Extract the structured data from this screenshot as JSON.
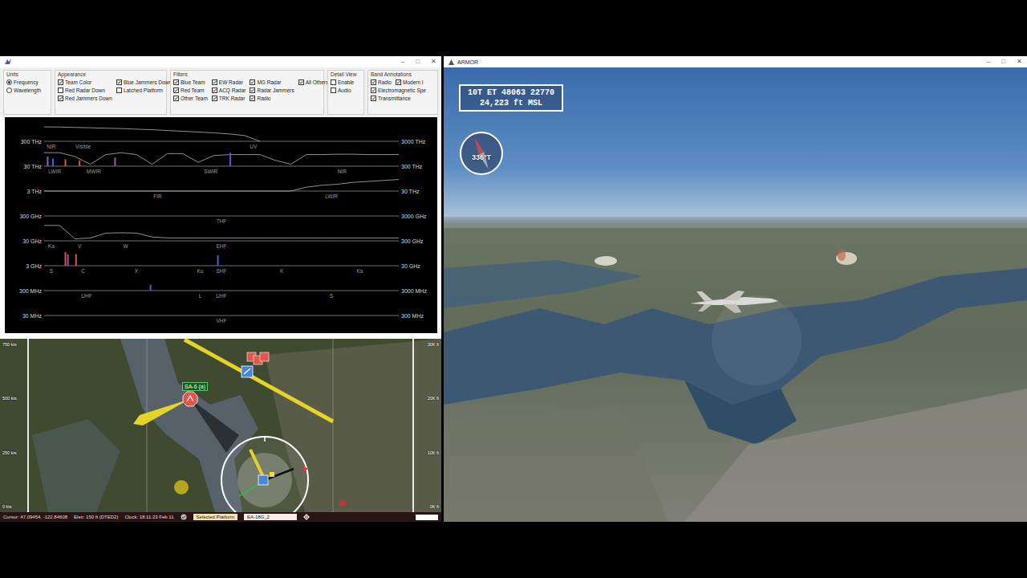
{
  "left_window": {
    "controls": [
      "–",
      "□",
      "✕"
    ],
    "option_groups": [
      {
        "title": "Units",
        "kind": "columns",
        "lines": [
          [
            {
              "label": "Frequency",
              "kind": "radio",
              "selected": true
            },
            {
              "label": "Wavelength",
              "kind": "radio",
              "selected": false
            }
          ]
        ]
      },
      {
        "title": "Appearance",
        "kind": "columns",
        "lines": [
          [
            {
              "label": "Team Color",
              "kind": "checkbox",
              "checked": true
            },
            {
              "label": "Red Radar Down",
              "kind": "checkbox",
              "checked": false
            },
            {
              "label": "Red Jammers Down",
              "kind": "checkbox",
              "checked": true
            }
          ],
          [
            {
              "label": "Blue Jammers Down",
              "kind": "checkbox",
              "checked": true
            },
            {
              "label": "Latched Platform",
              "kind": "checkbox",
              "checked": false
            }
          ]
        ]
      },
      {
        "title": "Filters",
        "kind": "columns",
        "lines": [
          [
            {
              "label": "Blue Team",
              "kind": "checkbox",
              "checked": true
            },
            {
              "label": "Red Team",
              "kind": "checkbox",
              "checked": true
            },
            {
              "label": "Other Team",
              "kind": "checkbox",
              "checked": true
            }
          ],
          [
            {
              "label": "EW Radar",
              "kind": "checkbox",
              "checked": true
            },
            {
              "label": "ACQ Radar",
              "kind": "checkbox",
              "checked": true
            },
            {
              "label": "TRK Radar",
              "kind": "checkbox",
              "checked": true
            }
          ],
          [
            {
              "label": "MG Radar",
              "kind": "checkbox",
              "checked": true
            },
            {
              "label": "Radar Jammers",
              "kind": "checkbox",
              "checked": true
            },
            {
              "label": "Radio",
              "kind": "checkbox",
              "checked": true
            }
          ],
          [
            {
              "label": "All Others",
              "kind": "checkbox",
              "checked": true
            }
          ]
        ]
      },
      {
        "title": "Detail View",
        "kind": "columns",
        "lines": [
          [
            {
              "label": "Enable",
              "kind": "checkbox",
              "checked": false
            },
            {
              "label": "Audio",
              "kind": "checkbox",
              "checked": false
            }
          ]
        ]
      },
      {
        "title": "Band Annotations",
        "kind": "rows",
        "lines": [
          [
            {
              "label": "Radio",
              "kind": "checkbox",
              "checked": true
            },
            {
              "label": "Modern I",
              "kind": "checkbox",
              "checked": true
            }
          ],
          [
            {
              "label": "Electromagnetic Spe",
              "kind": "checkbox",
              "checked": true
            }
          ],
          [
            {
              "label": "Transmittance",
              "kind": "checkbox",
              "checked": true
            }
          ]
        ]
      }
    ],
    "spectrum": {
      "rows": [
        {
          "left": "300 THz",
          "right": "3000 THz",
          "bands": [
            {
              "label": "NIR",
              "at": 0.02
            },
            {
              "label": "Visible",
              "at": 0.11
            },
            {
              "label": "UV",
              "at": 0.59
            }
          ],
          "transmittance": [
            0.75,
            0.74,
            0.72,
            0.7,
            0.68,
            0.66,
            0.63,
            0.6,
            0.56,
            0.52,
            0.48,
            0.44,
            0.38,
            0.3,
            0.0
          ],
          "signals": []
        },
        {
          "left": "30 THz",
          "right": "300 THz",
          "bands": [
            {
              "label": "LWIR",
              "at": 0.03
            },
            {
              "label": "MWIR",
              "at": 0.14
            },
            {
              "label": "SWIR",
              "at": 0.47
            },
            {
              "label": "NIR",
              "at": 0.84
            }
          ],
          "transmittance": [
            0.7,
            0.7,
            0.5,
            0.1,
            0.6,
            0.7,
            0.6,
            0.1,
            0.65,
            0.65,
            0.2,
            0.55,
            0.6,
            0.6,
            0.6,
            0.3,
            0.1,
            0.6,
            0.6,
            0.62,
            0.62,
            0.6,
            0.6,
            0.6
          ],
          "signals": [
            {
              "at": 0.01,
              "level": 0.5,
              "color": "#9b59b6"
            },
            {
              "at": 0.025,
              "level": 0.4,
              "color": "#4a5bd6"
            },
            {
              "at": 0.06,
              "level": 0.35,
              "color": "#d9534f"
            },
            {
              "at": 0.1,
              "level": 0.3,
              "color": "#d9534f"
            },
            {
              "at": 0.2,
              "level": 0.45,
              "color": "#9b59b6"
            },
            {
              "at": 0.525,
              "level": 0.7,
              "color": "#5a4fe0"
            }
          ]
        },
        {
          "left": "3 THz",
          "right": "30 THz",
          "bands": [
            {
              "label": "FIR",
              "at": 0.32
            },
            {
              "label": "LWIR",
              "at": 0.81
            }
          ],
          "transmittance": [
            0,
            0,
            0,
            0,
            0,
            0,
            0,
            0,
            0,
            0,
            0,
            0,
            0,
            0,
            0,
            0,
            0,
            0.2,
            0.3,
            0.35,
            0.45,
            0.5,
            0.55,
            0.6
          ],
          "signals": []
        },
        {
          "left": "300 GHz",
          "right": "3000 GHz",
          "bands": [
            {
              "label": "THF",
              "at": 0.5
            }
          ],
          "transmittance": [],
          "signals": []
        },
        {
          "left": "30 GHz",
          "right": "300 GHz",
          "bands": [
            {
              "label": "Ka",
              "at": 0.02
            },
            {
              "label": "V",
              "at": 0.1
            },
            {
              "label": "W",
              "at": 0.23
            },
            {
              "label": "EHF",
              "at": 0.5
            }
          ],
          "transmittance": [
            0.8,
            0.8,
            0.1,
            0.15,
            0.4,
            0.42,
            0.4,
            0.2,
            0.15,
            0.15,
            0.15,
            0.15,
            0.15,
            0.15,
            0.15,
            0.15,
            0.15,
            0.15,
            0.15,
            0.15,
            0.15,
            0.15,
            0.15,
            0.15
          ],
          "signals": []
        },
        {
          "left": "3 GHz",
          "right": "30 GHz",
          "bands": [
            {
              "label": "S",
              "at": 0.02
            },
            {
              "label": "C",
              "at": 0.11
            },
            {
              "label": "X",
              "at": 0.26
            },
            {
              "label": "Ku",
              "at": 0.44
            },
            {
              "label": "SHF",
              "at": 0.5
            },
            {
              "label": "K",
              "at": 0.67
            },
            {
              "label": "Ka",
              "at": 0.89
            }
          ],
          "transmittance": [],
          "signals": [
            {
              "at": 0.06,
              "level": 0.7,
              "color": "#d9534f"
            },
            {
              "at": 0.067,
              "level": 0.6,
              "color": "#9b59b6"
            },
            {
              "at": 0.09,
              "level": 0.6,
              "color": "#d9534f"
            },
            {
              "at": 0.49,
              "level": 0.55,
              "color": "#4a5bd6"
            }
          ]
        },
        {
          "left": "300 MHz",
          "right": "3000 MHz",
          "bands": [
            {
              "label": "UHF",
              "at": 0.12
            },
            {
              "label": "L",
              "at": 0.44
            },
            {
              "label": "UHF",
              "at": 0.5
            },
            {
              "label": "S",
              "at": 0.81
            }
          ],
          "transmittance": [],
          "signals": [
            {
              "at": 0.3,
              "level": 0.3,
              "color": "#4a5bd6"
            }
          ]
        },
        {
          "left": "30 MHz",
          "right": "300 MHz",
          "bands": [
            {
              "label": "VHF",
              "at": 0.5
            }
          ],
          "transmittance": [],
          "signals": []
        }
      ]
    },
    "map": {
      "scale_left": [
        "750 kts",
        "500 kts",
        "250 kts",
        "0 kts"
      ],
      "scale_right": [
        "30K ft",
        "20K ft",
        "10K ft",
        "0K ft"
      ],
      "markers": [
        {
          "kind": "threat",
          "label": "SA-6 (a)",
          "color": "#e2574c"
        },
        {
          "kind": "threat-group",
          "label": "",
          "color": "#e2574c"
        },
        {
          "kind": "friendly",
          "label": "",
          "color": "#4a86d8"
        },
        {
          "kind": "threat-dot",
          "label": "",
          "color": "#c0392b"
        }
      ]
    },
    "status_bar": {
      "cursor": "Cursor: 47.09454, -122.84608",
      "elevation": "Elev: 150 ft (DTED2)",
      "clock": "Clock: 18:11:23  Feb 11",
      "selected_platform_label": "Selected Platform",
      "selected_platform": "EA-18G_2"
    }
  },
  "view_window": {
    "title": "ARMOR",
    "controls": [
      "–",
      "□",
      "✕"
    ],
    "position": "10T ET 48063 22770",
    "altitude": "24,223 ft MSL",
    "heading": "336°T"
  }
}
